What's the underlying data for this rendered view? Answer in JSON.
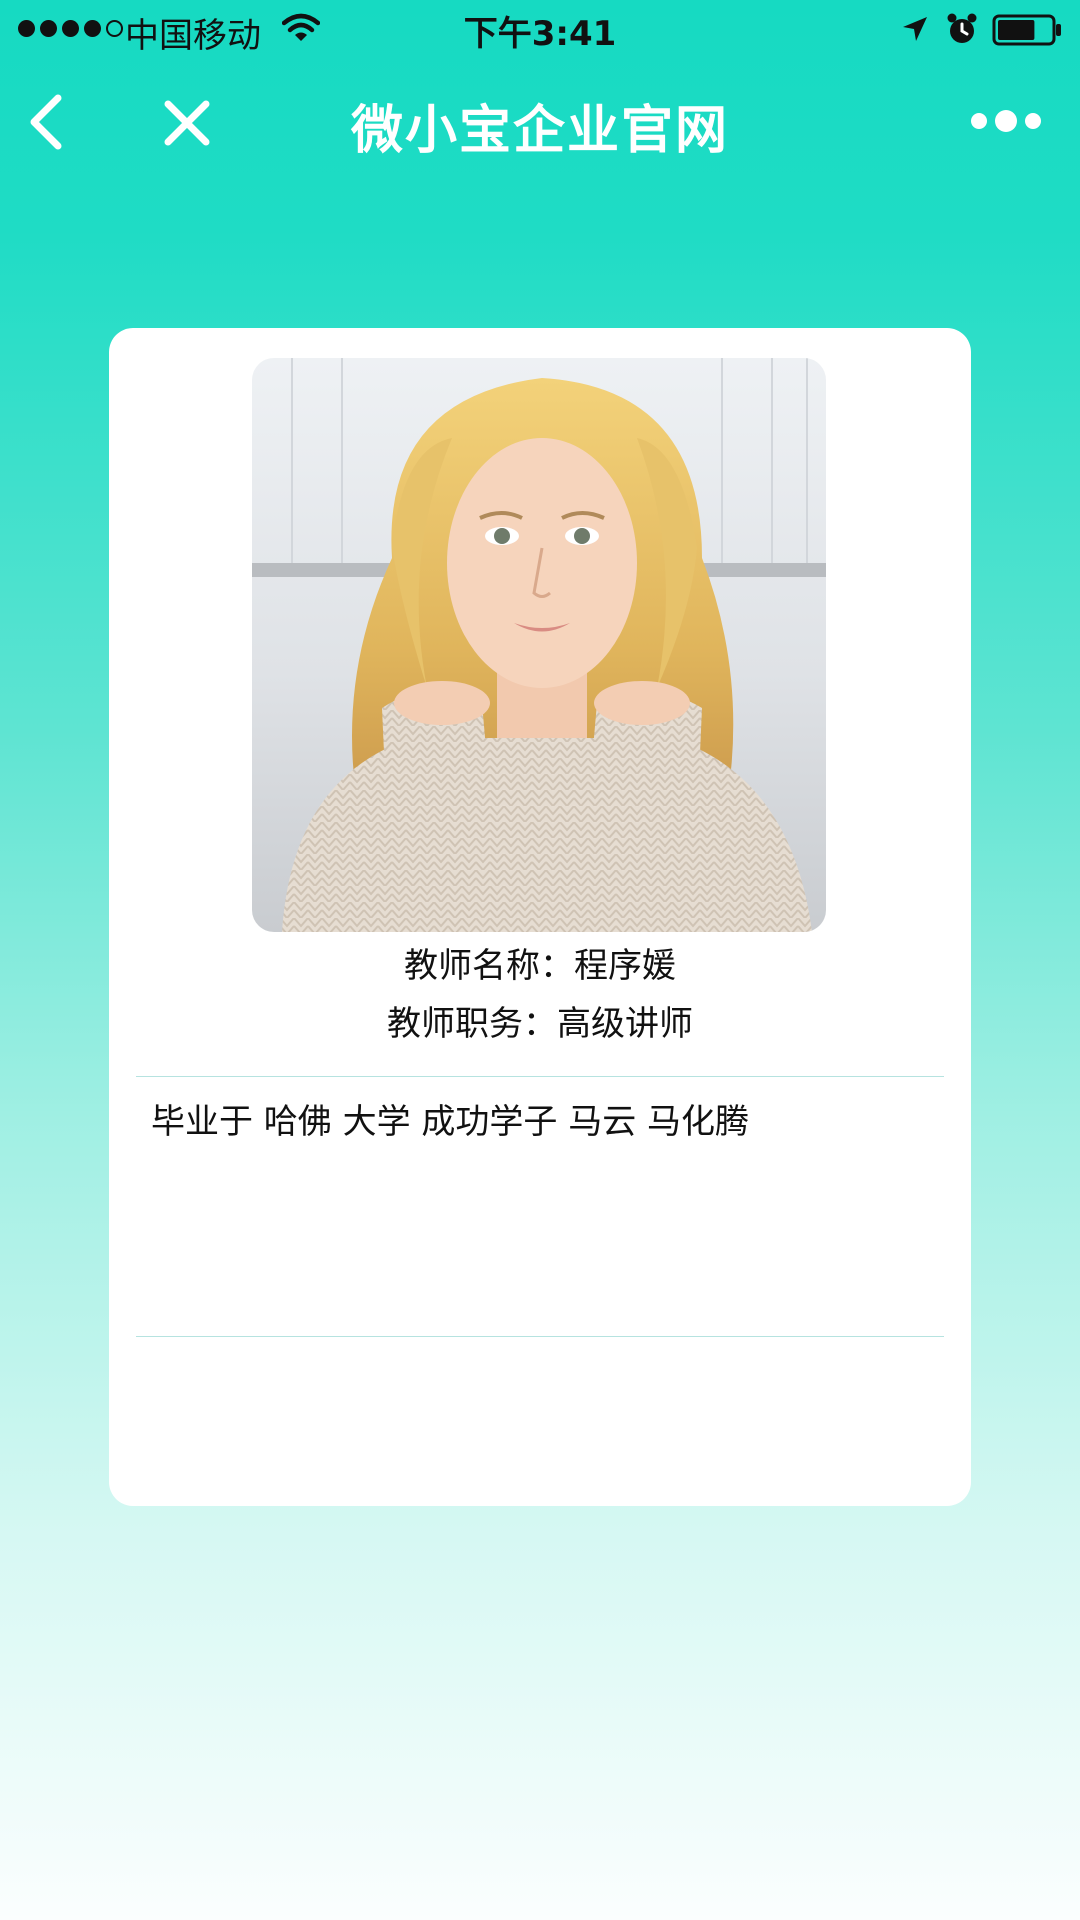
{
  "status_bar": {
    "signal_dots_filled": 4,
    "signal_dots_empty": 1,
    "carrier": "中国移动",
    "time": "下午3:41",
    "battery_level": 0.7,
    "icons": [
      "wifi-icon",
      "location-arrow-icon",
      "alarm-icon",
      "battery-icon"
    ]
  },
  "nav": {
    "title": "微小宝企业官网",
    "back_icon": "chevron-left-icon",
    "close_icon": "close-icon",
    "more_icon": "more-dots-icon"
  },
  "teacher": {
    "photo_icon": "teacher-photo",
    "name_line": "教师名称：程序媛",
    "position_line": "教师职务：高级讲师",
    "bio": "毕业于 哈佛 大学 成功学子 马云 马化腾"
  },
  "colors": {
    "accent": "#16dac2",
    "card": "#ffffff",
    "divider": "#b6e3e0"
  }
}
